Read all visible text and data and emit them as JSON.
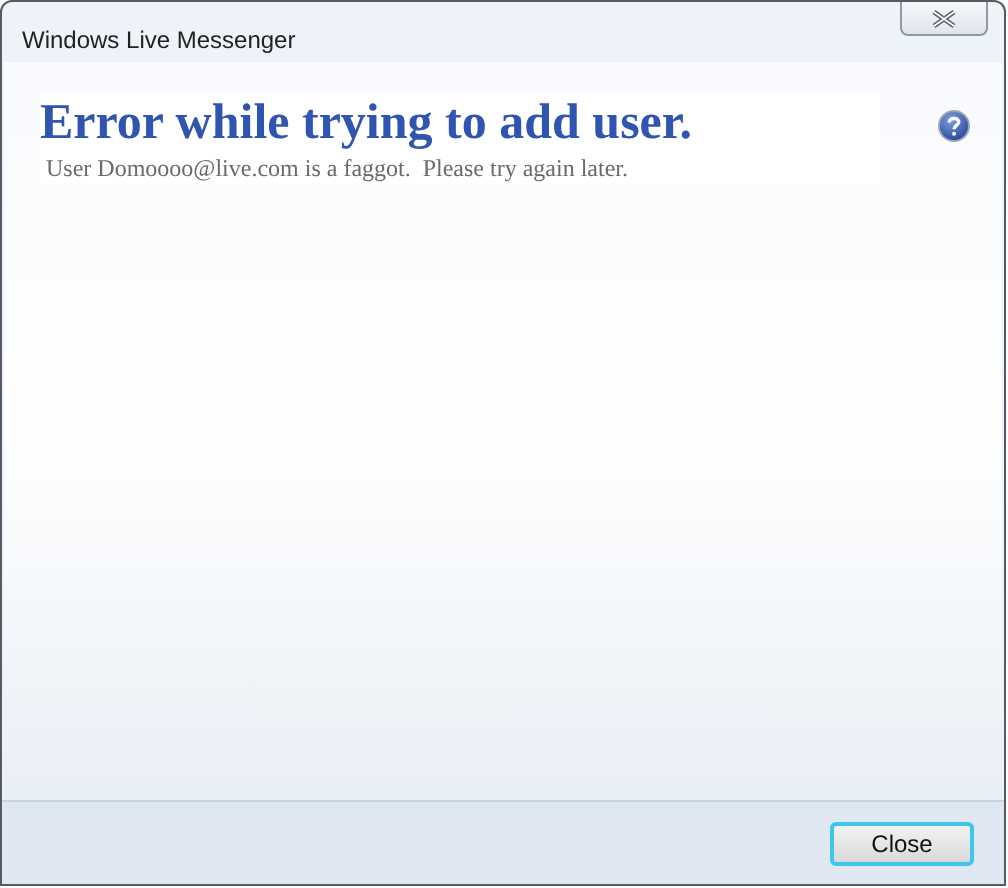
{
  "window": {
    "title": "Windows Live Messenger"
  },
  "error": {
    "heading": "Error while trying to add user.",
    "message": "User Domoooo@live.com is a faggot.  Please try again later."
  },
  "buttons": [
    {
      "label": "Close",
      "focused": true
    }
  ]
}
